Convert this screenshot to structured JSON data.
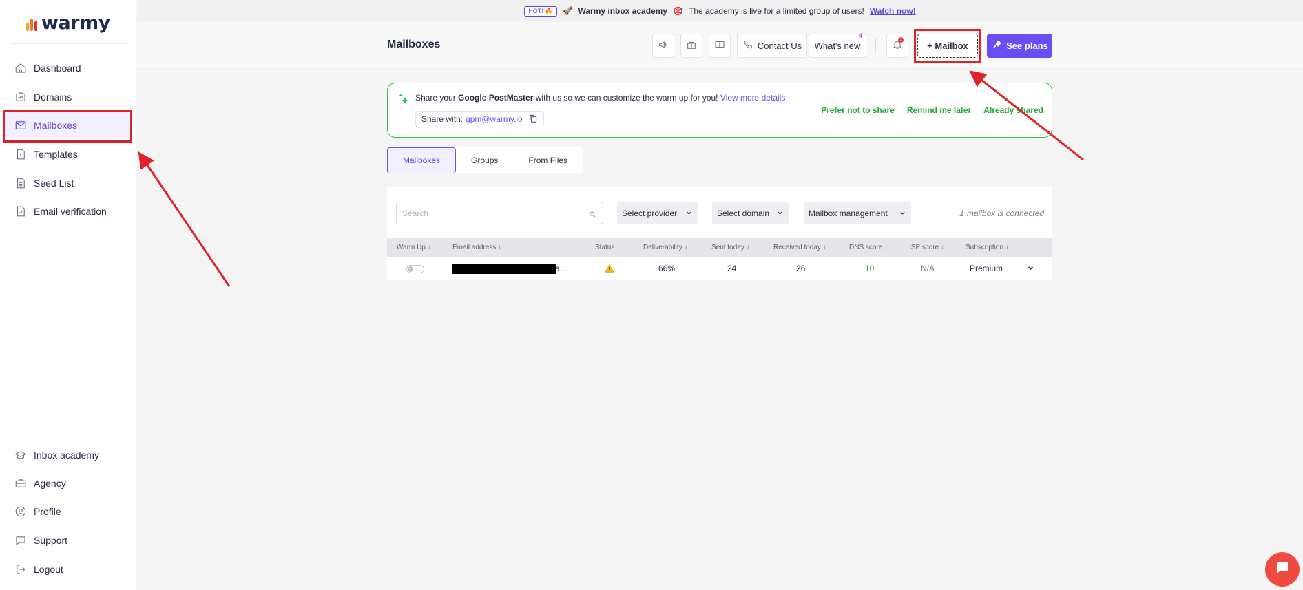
{
  "brand": {
    "logo_text": "warmy"
  },
  "banner": {
    "hot": "HOT! 🔥",
    "title": "Warmy inbox academy",
    "text": "The academy is live for a limited group of users!",
    "link": "Watch now!"
  },
  "sidebar": {
    "top_items": [
      {
        "label": "Dashboard",
        "icon": "home-icon"
      },
      {
        "label": "Domains",
        "icon": "domains-icon"
      },
      {
        "label": "Mailboxes",
        "icon": "envelope-icon",
        "active": true
      },
      {
        "label": "Templates",
        "icon": "template-icon"
      },
      {
        "label": "Seed List",
        "icon": "document-icon"
      },
      {
        "label": "Email verification",
        "icon": "verify-icon"
      }
    ],
    "bottom_items": [
      {
        "label": "Inbox academy",
        "icon": "graduation-cap-icon"
      },
      {
        "label": "Agency",
        "icon": "briefcase-icon"
      },
      {
        "label": "Profile",
        "icon": "profile-icon"
      },
      {
        "label": "Support",
        "icon": "chat-icon"
      },
      {
        "label": "Logout",
        "icon": "logout-icon"
      }
    ]
  },
  "header": {
    "title": "Mailboxes",
    "contact": "Contact Us",
    "whats_new": "What's new",
    "whats_new_count": "4",
    "notif_count": "1",
    "add_mailbox": "+ Mailbox",
    "see_plans": "See plans"
  },
  "gpm": {
    "text_pre": "Share your ",
    "text_bold": "Google PostMaster",
    "text_post": " with us so we can customize the warm up for you!",
    "link": "View more details",
    "share_label": "Share with:",
    "share_email": "gpm@warmy.io",
    "prefer_not": "Prefer not to share",
    "remind": "Remind me later",
    "already": "Already shared"
  },
  "tabs": [
    "Mailboxes",
    "Groups",
    "From Files"
  ],
  "filters": {
    "search_placeholder": "Search",
    "provider": "Select provider",
    "domain": "Select domain",
    "management": "Mailbox management",
    "connected_count": "1",
    "connected_text": "mailbox is connected"
  },
  "table": {
    "columns": [
      "Warm Up",
      "Email address",
      "Status",
      "Deliverability",
      "Sent today",
      "Received today",
      "DNS score",
      "ISP score",
      "Subscription"
    ],
    "rows": [
      {
        "email_tail": "a...",
        "deliverability": "66%",
        "sent": "24",
        "received": "26",
        "dns": "10",
        "isp": "N/A",
        "subscription": "Premium"
      }
    ]
  },
  "colors": {
    "accent": "#6a4df4",
    "success": "#1ea82f",
    "annotation": "#e0222a"
  }
}
